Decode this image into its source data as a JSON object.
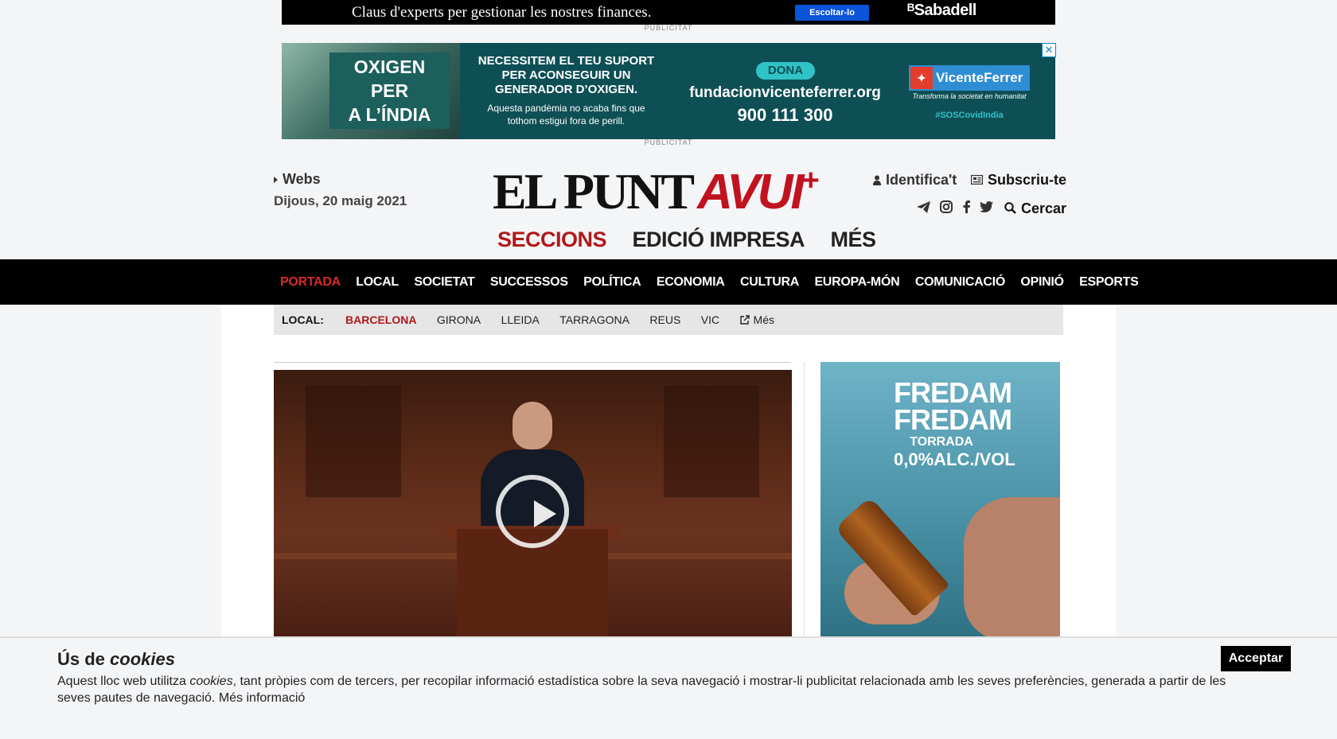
{
  "ads": {
    "top": {
      "text": "Claus d'experts per gestionar les nostres finances.",
      "button": "Escoltar-lo",
      "brand": "ᴮSabadell",
      "label": "PUBLICITAT"
    },
    "second": {
      "headline_1": "OXIGEN PER",
      "headline_2": "A L’ÍNDIA",
      "message": "NECESSITEM EL TEU SUPORT PER ACONSEGUIR UN GENERADOR D’OXIGEN.",
      "sub": "Aquesta pandèmia no acaba fins que tothom estigui fora de perill.",
      "donate": "DONA",
      "url": "fundacionvicenteferrer.org",
      "phone": "900 111 300",
      "brand": "VicenteFerrer",
      "tagline": "Transforma la societat en humanitat",
      "hashtag": "#SOSCovidIndia",
      "label": "PUBLICITAT"
    },
    "side": {
      "brand": "FREDAM FREDAM",
      "variant": "TORRADA",
      "alc": "0,0%ALC./VOL"
    }
  },
  "header": {
    "webs": "Webs",
    "date": "Dijous, 20 maig 2021",
    "logo_part1": "EL PUNT",
    "logo_part2": "AVUI",
    "logo_plus": "+",
    "login": "Identifica't",
    "subscribe": "Subscriu-te",
    "search": "Cercar",
    "sections": [
      "SECCIONS",
      "EDICIÓ IMPRESA",
      "MÉS"
    ]
  },
  "main_nav": [
    "PORTADA",
    "LOCAL",
    "SOCIETAT",
    "SUCCESSOS",
    "POLÍTICA",
    "ECONOMIA",
    "CULTURA",
    "EUROPA-MÓN",
    "COMUNICACIÓ",
    "OPINIÓ",
    "ESPORTS"
  ],
  "local_nav": {
    "label": "LOCAL:",
    "items": [
      "BARCELONA",
      "GIRONA",
      "LLEIDA",
      "TARRAGONA",
      "REUS",
      "VIC"
    ],
    "more": "Més"
  },
  "cookie": {
    "title_plain": "Ús de",
    "title_em": "cookies",
    "text_a": "Aquest lloc web utilitza",
    "text_em": "cookies",
    "text_b": ", tant pròpies com de tercers, per recopilar informació estadística sobre la seva navegació i mostrar-li publicitat relacionada amb les seves preferències, generada a partir de les seves pautes de navegació.",
    "more_link": "Més informació",
    "accept": "Acceptar"
  },
  "colors": {
    "brand_red": "#c1121f",
    "nav_bg": "#000000",
    "active_red": "#d92b2b"
  }
}
